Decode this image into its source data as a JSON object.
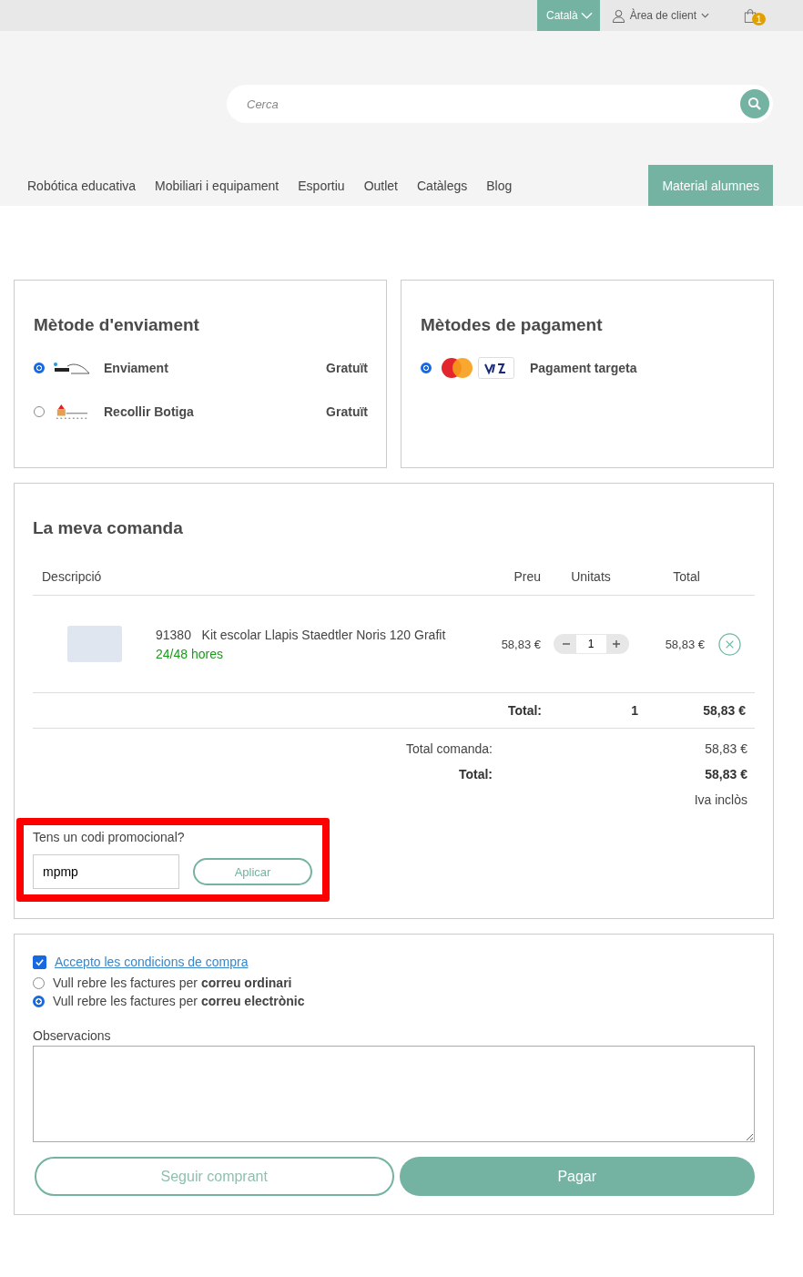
{
  "top_bar": {
    "language": "Català",
    "account": "Àrea de client",
    "cart_count": "1"
  },
  "search": {
    "placeholder": "Cerca"
  },
  "nav": {
    "items": [
      "Robótica educativa",
      "Mobiliari i equipament",
      "Esportiu",
      "Outlet",
      "Catàlegs",
      "Blog"
    ],
    "highlight": "Material alumnes"
  },
  "shipping": {
    "title": "Mètode d'enviament",
    "options": [
      {
        "kind": "carrier",
        "label": "Enviament",
        "price": "Gratuït",
        "selected": true
      },
      {
        "kind": "store",
        "label": "Recollir Botiga",
        "price": "Gratuït",
        "selected": false
      }
    ]
  },
  "payment": {
    "title": "Mètodes de pagament",
    "options": [
      {
        "kind": "card",
        "label": "Pagament targeta",
        "selected": true
      }
    ]
  },
  "order": {
    "title": "La meva comanda",
    "columns": [
      "Descripció",
      "Preu",
      "Unitats",
      "Total"
    ],
    "items": [
      {
        "code": "91380",
        "name": "Kit escolar Llapis Staedtler Noris 120 Grafit",
        "delivery": "24/48 hores",
        "price": "58,83 €",
        "quantity": "1",
        "total": "58,83 €"
      }
    ],
    "subtotal": {
      "label": "Total:",
      "units": "1",
      "amount": "58,83 €"
    },
    "summary": [
      {
        "kind": "normal",
        "label": "Total comanda:",
        "value": "58,83 €"
      },
      {
        "kind": "bold",
        "label": "Total:",
        "value": "58,83 €"
      }
    ],
    "tax_note": "Iva inclòs"
  },
  "promo": {
    "highlighted": true,
    "label": "Tens un codi promocional?",
    "value": "mpmp",
    "button": "Aplicar"
  },
  "terms": {
    "label": "Accepto les condicions de compra",
    "checked": true
  },
  "invoice_options": [
    {
      "text": "Vull rebre les factures per **correu ordinari**",
      "selected": false
    },
    {
      "text": "Vull rebre les factures per **correu electrònic**",
      "selected": true
    }
  ],
  "observations": {
    "label": "Observacions"
  },
  "buttons": {
    "continue": "Seguir comprant",
    "pay": "Pagar"
  }
}
